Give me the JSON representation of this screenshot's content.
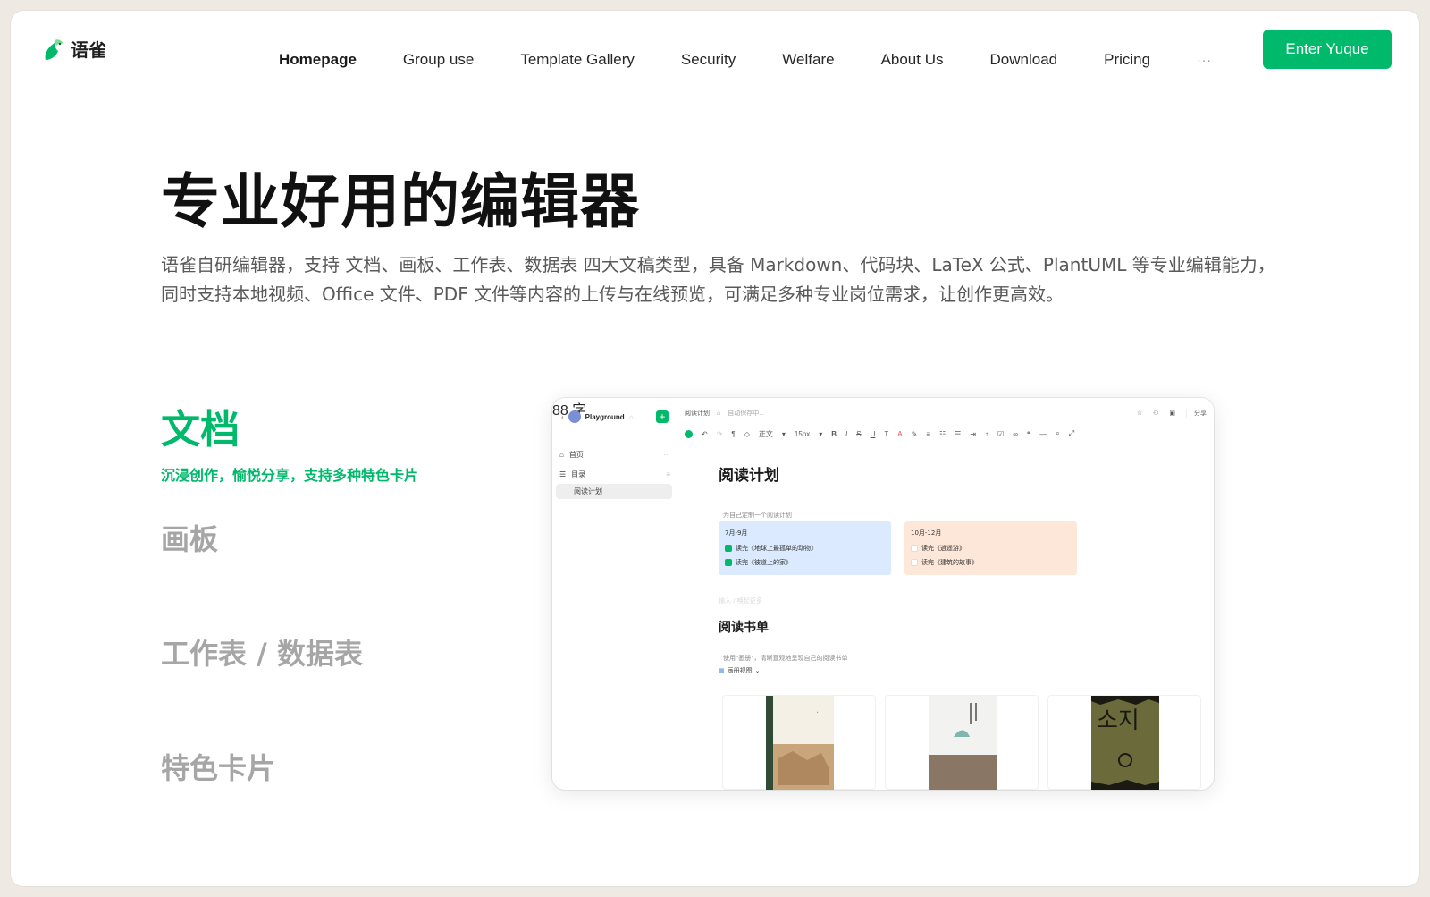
{
  "brand": {
    "name": "语雀",
    "accent": "#00b96b"
  },
  "nav": {
    "items": [
      {
        "label": "Homepage",
        "active": true
      },
      {
        "label": "Group use"
      },
      {
        "label": "Template Gallery"
      },
      {
        "label": "Security"
      },
      {
        "label": "Welfare"
      },
      {
        "label": "About Us"
      },
      {
        "label": "Download"
      },
      {
        "label": "Pricing"
      }
    ],
    "more": "···",
    "cta": "Enter Yuque"
  },
  "hero": {
    "title": "专业好用的编辑器",
    "desc": "语雀自研编辑器，支持 文档、画板、工作表、数据表 四大文稿类型，具备 Markdown、代码块、LaTeX 公式、PlantUML 等专业编辑能力，同时支持本地视频、Office 文件、PDF 文件等内容的上传与在线预览，可满足多种专业岗位需求，让创作更高效。"
  },
  "features": [
    {
      "title": "文档",
      "subtitle": "沉浸创作，愉悦分享，支持多种特色卡片",
      "active": true
    },
    {
      "title": "画板"
    },
    {
      "title": "工作表 / 数据表"
    },
    {
      "title": "特色卡片"
    }
  ],
  "editor": {
    "sidebar": {
      "workspace": "Playground",
      "items": [
        "首页",
        "目录",
        "阅读计划"
      ],
      "word_count": "88 字"
    },
    "top": {
      "doc_name": "阅读计划",
      "save_status": "自动保存中...",
      "share": "分享"
    },
    "toolbar": {
      "style": "正文",
      "size": "15px"
    },
    "doc": {
      "title": "阅读计划",
      "intro": "为自己定制一个阅读计划",
      "cards": [
        {
          "title": "7月-9月",
          "color": "#dbeafe",
          "items": [
            {
              "text": "读完《地球上最孤单的动物》",
              "checked": true
            },
            {
              "text": "读完《彼道上的家》",
              "checked": true
            }
          ]
        },
        {
          "title": "10月-12月",
          "color": "#fde7d8",
          "items": [
            {
              "text": "读完《逍遥游》",
              "checked": false
            },
            {
              "text": "读完《建筑的故事》",
              "checked": false
            }
          ]
        }
      ],
      "placeholder": "输入 / 唤起更多",
      "section_title": "阅读书单",
      "section_desc": "使用\"画册\"，清晰直观地呈现自己的阅读书单",
      "view_label": "画册视图"
    }
  }
}
